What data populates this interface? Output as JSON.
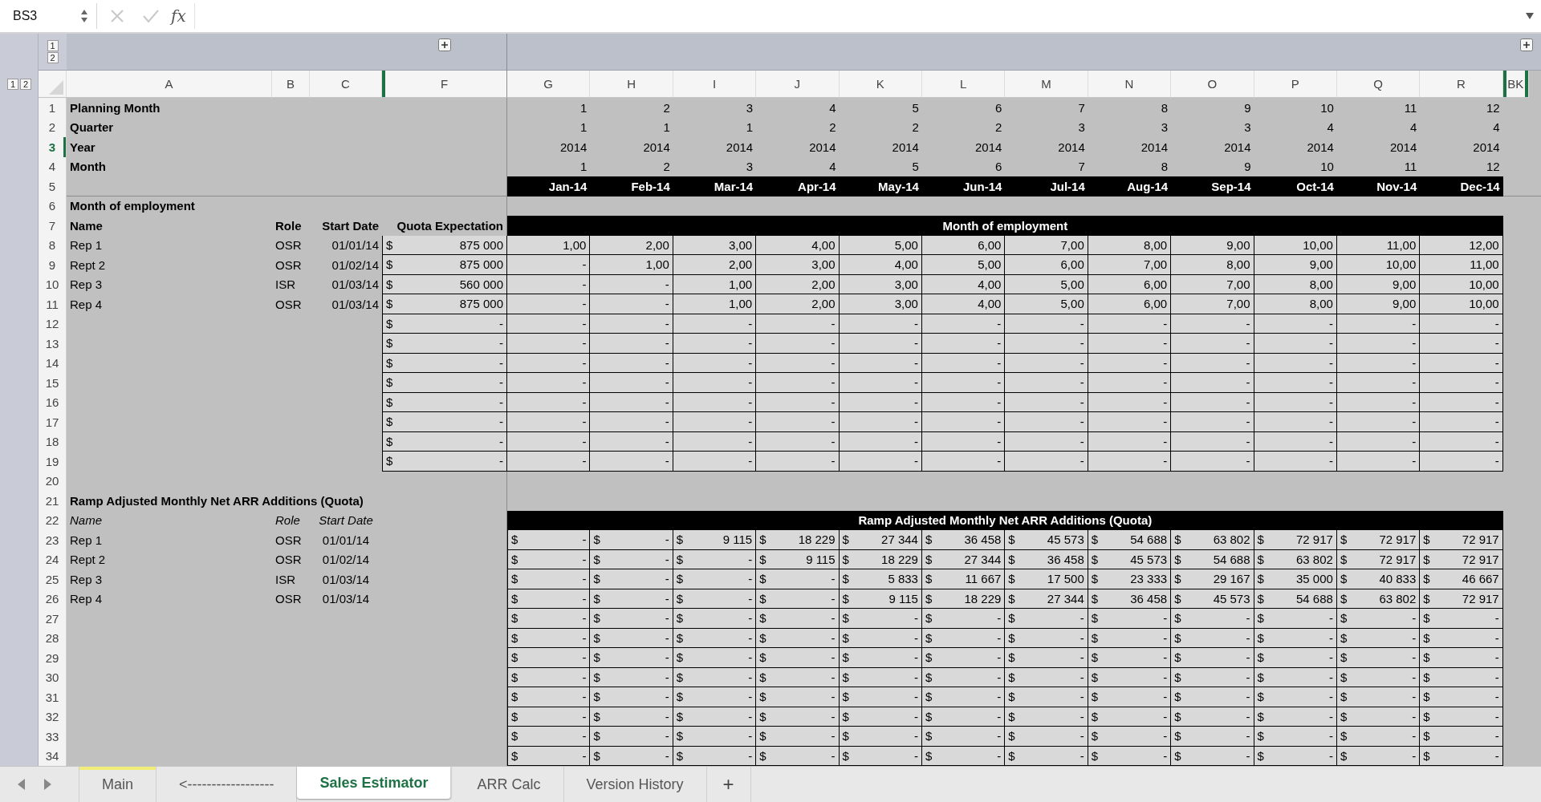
{
  "formula_bar": {
    "name_box": "BS3",
    "function_label": "fx"
  },
  "outline": {
    "row_levels": [
      "1",
      "2"
    ],
    "column_levels": [
      "1",
      "2"
    ]
  },
  "columns": [
    {
      "label": "A"
    },
    {
      "label": "B"
    },
    {
      "label": "C"
    },
    {
      "label": "F",
      "hidden_before": true,
      "hidden_after": false
    },
    {
      "label": "G"
    },
    {
      "label": "H"
    },
    {
      "label": "I"
    },
    {
      "label": "J"
    },
    {
      "label": "K"
    },
    {
      "label": "L"
    },
    {
      "label": "M"
    },
    {
      "label": "N"
    },
    {
      "label": "O"
    },
    {
      "label": "P"
    },
    {
      "label": "Q"
    },
    {
      "label": "R"
    },
    {
      "label": "BK",
      "hidden_before": true,
      "hidden_after": true
    }
  ],
  "rows": [
    {
      "number": "1",
      "selected": false,
      "kind": "values",
      "label": "Planning Month",
      "values": [
        "1",
        "2",
        "3",
        "4",
        "5",
        "6",
        "7",
        "8",
        "9",
        "10",
        "11",
        "12"
      ]
    },
    {
      "number": "2",
      "selected": false,
      "kind": "values",
      "label": "Quarter",
      "values": [
        "1",
        "1",
        "1",
        "2",
        "2",
        "2",
        "3",
        "3",
        "3",
        "4",
        "4",
        "4"
      ]
    },
    {
      "number": "3",
      "selected": true,
      "kind": "values",
      "label": "Year",
      "values": [
        "2014",
        "2014",
        "2014",
        "2014",
        "2014",
        "2014",
        "2014",
        "2014",
        "2014",
        "2014",
        "2014",
        "2014"
      ]
    },
    {
      "number": "4",
      "selected": false,
      "kind": "values",
      "label": "Month",
      "values": [
        "1",
        "2",
        "3",
        "4",
        "5",
        "6",
        "7",
        "8",
        "9",
        "10",
        "11",
        "12"
      ]
    },
    {
      "number": "5",
      "selected": false,
      "kind": "months",
      "values": [
        "Jan-14",
        "Feb-14",
        "Mar-14",
        "Apr-14",
        "May-14",
        "Jun-14",
        "Jul-14",
        "Aug-14",
        "Sep-14",
        "Oct-14",
        "Nov-14",
        "Dec-14"
      ]
    },
    {
      "number": "6",
      "selected": false,
      "kind": "section",
      "label": "Month of employment"
    },
    {
      "number": "7",
      "selected": false,
      "kind": "head",
      "italic": false,
      "label": "Name",
      "role": "Role",
      "start": "Start Date",
      "quota": "Quota Expectation",
      "band": "Month of employment"
    },
    {
      "number": "8",
      "selected": false,
      "kind": "employee",
      "name": "Rep 1",
      "role": "OSR",
      "start": "01/01/14",
      "quota": [
        "$",
        "875 000"
      ],
      "values": [
        "1,00",
        "2,00",
        "3,00",
        "4,00",
        "5,00",
        "6,00",
        "7,00",
        "8,00",
        "9,00",
        "10,00",
        "11,00",
        "12,00"
      ]
    },
    {
      "number": "9",
      "selected": false,
      "kind": "employee",
      "name": "Rept 2",
      "role": "OSR",
      "start": "01/02/14",
      "quota": [
        "$",
        "875 000"
      ],
      "values": [
        "-",
        "1,00",
        "2,00",
        "3,00",
        "4,00",
        "5,00",
        "6,00",
        "7,00",
        "8,00",
        "9,00",
        "10,00",
        "11,00"
      ]
    },
    {
      "number": "10",
      "selected": false,
      "kind": "employee",
      "name": "Rep 3",
      "role": "ISR",
      "start": "01/03/14",
      "quota": [
        "$",
        "560 000"
      ],
      "values": [
        "-",
        "-",
        "1,00",
        "2,00",
        "3,00",
        "4,00",
        "5,00",
        "6,00",
        "7,00",
        "8,00",
        "9,00",
        "10,00"
      ]
    },
    {
      "number": "11",
      "selected": false,
      "kind": "employee",
      "name": "Rep 4",
      "role": "OSR",
      "start": "01/03/14",
      "quota": [
        "$",
        "875 000"
      ],
      "values": [
        "-",
        "-",
        "1,00",
        "2,00",
        "3,00",
        "4,00",
        "5,00",
        "6,00",
        "7,00",
        "8,00",
        "9,00",
        "10,00"
      ]
    },
    {
      "number": "12",
      "selected": false,
      "kind": "employee",
      "quota": [
        "$",
        "-"
      ],
      "values": [
        "-",
        "-",
        "-",
        "-",
        "-",
        "-",
        "-",
        "-",
        "-",
        "-",
        "-",
        "-"
      ]
    },
    {
      "number": "13",
      "selected": false,
      "kind": "employee",
      "quota": [
        "$",
        "-"
      ],
      "values": [
        "-",
        "-",
        "-",
        "-",
        "-",
        "-",
        "-",
        "-",
        "-",
        "-",
        "-",
        "-"
      ]
    },
    {
      "number": "14",
      "selected": false,
      "kind": "employee",
      "quota": [
        "$",
        "-"
      ],
      "values": [
        "-",
        "-",
        "-",
        "-",
        "-",
        "-",
        "-",
        "-",
        "-",
        "-",
        "-",
        "-"
      ]
    },
    {
      "number": "15",
      "selected": false,
      "kind": "employee",
      "quota": [
        "$",
        "-"
      ],
      "values": [
        "-",
        "-",
        "-",
        "-",
        "-",
        "-",
        "-",
        "-",
        "-",
        "-",
        "-",
        "-"
      ]
    },
    {
      "number": "16",
      "selected": false,
      "kind": "employee",
      "quota": [
        "$",
        "-"
      ],
      "values": [
        "-",
        "-",
        "-",
        "-",
        "-",
        "-",
        "-",
        "-",
        "-",
        "-",
        "-",
        "-"
      ]
    },
    {
      "number": "17",
      "selected": false,
      "kind": "employee",
      "quota": [
        "$",
        "-"
      ],
      "values": [
        "-",
        "-",
        "-",
        "-",
        "-",
        "-",
        "-",
        "-",
        "-",
        "-",
        "-",
        "-"
      ]
    },
    {
      "number": "18",
      "selected": false,
      "kind": "employee",
      "quota": [
        "$",
        "-"
      ],
      "values": [
        "-",
        "-",
        "-",
        "-",
        "-",
        "-",
        "-",
        "-",
        "-",
        "-",
        "-",
        "-"
      ]
    },
    {
      "number": "19",
      "selected": false,
      "kind": "employee",
      "quota": [
        "$",
        "-"
      ],
      "values": [
        "-",
        "-",
        "-",
        "-",
        "-",
        "-",
        "-",
        "-",
        "-",
        "-",
        "-",
        "-"
      ]
    },
    {
      "number": "20",
      "selected": false,
      "kind": "blank"
    },
    {
      "number": "21",
      "selected": false,
      "kind": "section",
      "label": "Ramp Adjusted Monthly Net ARR Additions (Quota)"
    },
    {
      "number": "22",
      "selected": false,
      "kind": "head",
      "italic": true,
      "label": "Name",
      "role": "Role",
      "start": "Start Date",
      "band": "Ramp Adjusted Monthly Net ARR Additions (Quota)"
    },
    {
      "number": "23",
      "selected": false,
      "kind": "ramp",
      "name": "Rep 1",
      "role": "OSR",
      "start": "01/01/14",
      "values": [
        [
          "$",
          "-"
        ],
        [
          "$",
          "-"
        ],
        [
          "$",
          "9 115"
        ],
        [
          "$",
          "18 229"
        ],
        [
          "$",
          "27 344"
        ],
        [
          "$",
          "36 458"
        ],
        [
          "$",
          "45 573"
        ],
        [
          "$",
          "54 688"
        ],
        [
          "$",
          "63 802"
        ],
        [
          "$",
          "72 917"
        ],
        [
          "$",
          "72 917"
        ],
        [
          "$",
          "72 917"
        ]
      ]
    },
    {
      "number": "24",
      "selected": false,
      "kind": "ramp",
      "name": "Rept 2",
      "role": "OSR",
      "start": "01/02/14",
      "values": [
        [
          "$",
          "-"
        ],
        [
          "$",
          "-"
        ],
        [
          "$",
          "-"
        ],
        [
          "$",
          "9 115"
        ],
        [
          "$",
          "18 229"
        ],
        [
          "$",
          "27 344"
        ],
        [
          "$",
          "36 458"
        ],
        [
          "$",
          "45 573"
        ],
        [
          "$",
          "54 688"
        ],
        [
          "$",
          "63 802"
        ],
        [
          "$",
          "72 917"
        ],
        [
          "$",
          "72 917"
        ]
      ]
    },
    {
      "number": "25",
      "selected": false,
      "kind": "ramp",
      "name": "Rep 3",
      "role": "ISR",
      "start": "01/03/14",
      "values": [
        [
          "$",
          "-"
        ],
        [
          "$",
          "-"
        ],
        [
          "$",
          "-"
        ],
        [
          "$",
          "-"
        ],
        [
          "$",
          "5 833"
        ],
        [
          "$",
          "11 667"
        ],
        [
          "$",
          "17 500"
        ],
        [
          "$",
          "23 333"
        ],
        [
          "$",
          "29 167"
        ],
        [
          "$",
          "35 000"
        ],
        [
          "$",
          "40 833"
        ],
        [
          "$",
          "46 667"
        ]
      ]
    },
    {
      "number": "26",
      "selected": false,
      "kind": "ramp",
      "name": "Rep 4",
      "role": "OSR",
      "start": "01/03/14",
      "values": [
        [
          "$",
          "-"
        ],
        [
          "$",
          "-"
        ],
        [
          "$",
          "-"
        ],
        [
          "$",
          "-"
        ],
        [
          "$",
          "9 115"
        ],
        [
          "$",
          "18 229"
        ],
        [
          "$",
          "27 344"
        ],
        [
          "$",
          "36 458"
        ],
        [
          "$",
          "45 573"
        ],
        [
          "$",
          "54 688"
        ],
        [
          "$",
          "63 802"
        ],
        [
          "$",
          "72 917"
        ]
      ]
    },
    {
      "number": "27",
      "selected": false,
      "kind": "ramp",
      "values": [
        [
          "$",
          "-"
        ],
        [
          "$",
          "-"
        ],
        [
          "$",
          "-"
        ],
        [
          "$",
          "-"
        ],
        [
          "$",
          "-"
        ],
        [
          "$",
          "-"
        ],
        [
          "$",
          "-"
        ],
        [
          "$",
          "-"
        ],
        [
          "$",
          "-"
        ],
        [
          "$",
          "-"
        ],
        [
          "$",
          "-"
        ],
        [
          "$",
          "-"
        ]
      ]
    },
    {
      "number": "28",
      "selected": false,
      "kind": "ramp",
      "values": [
        [
          "$",
          "-"
        ],
        [
          "$",
          "-"
        ],
        [
          "$",
          "-"
        ],
        [
          "$",
          "-"
        ],
        [
          "$",
          "-"
        ],
        [
          "$",
          "-"
        ],
        [
          "$",
          "-"
        ],
        [
          "$",
          "-"
        ],
        [
          "$",
          "-"
        ],
        [
          "$",
          "-"
        ],
        [
          "$",
          "-"
        ],
        [
          "$",
          "-"
        ]
      ]
    },
    {
      "number": "29",
      "selected": false,
      "kind": "ramp",
      "values": [
        [
          "$",
          "-"
        ],
        [
          "$",
          "-"
        ],
        [
          "$",
          "-"
        ],
        [
          "$",
          "-"
        ],
        [
          "$",
          "-"
        ],
        [
          "$",
          "-"
        ],
        [
          "$",
          "-"
        ],
        [
          "$",
          "-"
        ],
        [
          "$",
          "-"
        ],
        [
          "$",
          "-"
        ],
        [
          "$",
          "-"
        ],
        [
          "$",
          "-"
        ]
      ]
    },
    {
      "number": "30",
      "selected": false,
      "kind": "ramp",
      "values": [
        [
          "$",
          "-"
        ],
        [
          "$",
          "-"
        ],
        [
          "$",
          "-"
        ],
        [
          "$",
          "-"
        ],
        [
          "$",
          "-"
        ],
        [
          "$",
          "-"
        ],
        [
          "$",
          "-"
        ],
        [
          "$",
          "-"
        ],
        [
          "$",
          "-"
        ],
        [
          "$",
          "-"
        ],
        [
          "$",
          "-"
        ],
        [
          "$",
          "-"
        ]
      ]
    },
    {
      "number": "31",
      "selected": false,
      "kind": "ramp",
      "values": [
        [
          "$",
          "-"
        ],
        [
          "$",
          "-"
        ],
        [
          "$",
          "-"
        ],
        [
          "$",
          "-"
        ],
        [
          "$",
          "-"
        ],
        [
          "$",
          "-"
        ],
        [
          "$",
          "-"
        ],
        [
          "$",
          "-"
        ],
        [
          "$",
          "-"
        ],
        [
          "$",
          "-"
        ],
        [
          "$",
          "-"
        ],
        [
          "$",
          "-"
        ]
      ]
    },
    {
      "number": "32",
      "selected": false,
      "kind": "ramp",
      "values": [
        [
          "$",
          "-"
        ],
        [
          "$",
          "-"
        ],
        [
          "$",
          "-"
        ],
        [
          "$",
          "-"
        ],
        [
          "$",
          "-"
        ],
        [
          "$",
          "-"
        ],
        [
          "$",
          "-"
        ],
        [
          "$",
          "-"
        ],
        [
          "$",
          "-"
        ],
        [
          "$",
          "-"
        ],
        [
          "$",
          "-"
        ],
        [
          "$",
          "-"
        ]
      ]
    },
    {
      "number": "33",
      "selected": false,
      "kind": "ramp",
      "values": [
        [
          "$",
          "-"
        ],
        [
          "$",
          "-"
        ],
        [
          "$",
          "-"
        ],
        [
          "$",
          "-"
        ],
        [
          "$",
          "-"
        ],
        [
          "$",
          "-"
        ],
        [
          "$",
          "-"
        ],
        [
          "$",
          "-"
        ],
        [
          "$",
          "-"
        ],
        [
          "$",
          "-"
        ],
        [
          "$",
          "-"
        ],
        [
          "$",
          "-"
        ]
      ]
    },
    {
      "number": "34",
      "selected": false,
      "kind": "ramp",
      "values": [
        [
          "$",
          "-"
        ],
        [
          "$",
          "-"
        ],
        [
          "$",
          "-"
        ],
        [
          "$",
          "-"
        ],
        [
          "$",
          "-"
        ],
        [
          "$",
          "-"
        ],
        [
          "$",
          "-"
        ],
        [
          "$",
          "-"
        ],
        [
          "$",
          "-"
        ],
        [
          "$",
          "-"
        ],
        [
          "$",
          "-"
        ],
        [
          "$",
          "-"
        ]
      ]
    }
  ],
  "sheet_tabs": {
    "tabs": [
      {
        "label": "Main",
        "selected": false,
        "color": "#f0ee78"
      },
      {
        "label": "<------------------",
        "selected": false
      },
      {
        "label": "Sales Estimator",
        "selected": true
      },
      {
        "label": "ARR Calc",
        "selected": false
      },
      {
        "label": "Version History",
        "selected": false
      }
    ],
    "add": "+"
  }
}
